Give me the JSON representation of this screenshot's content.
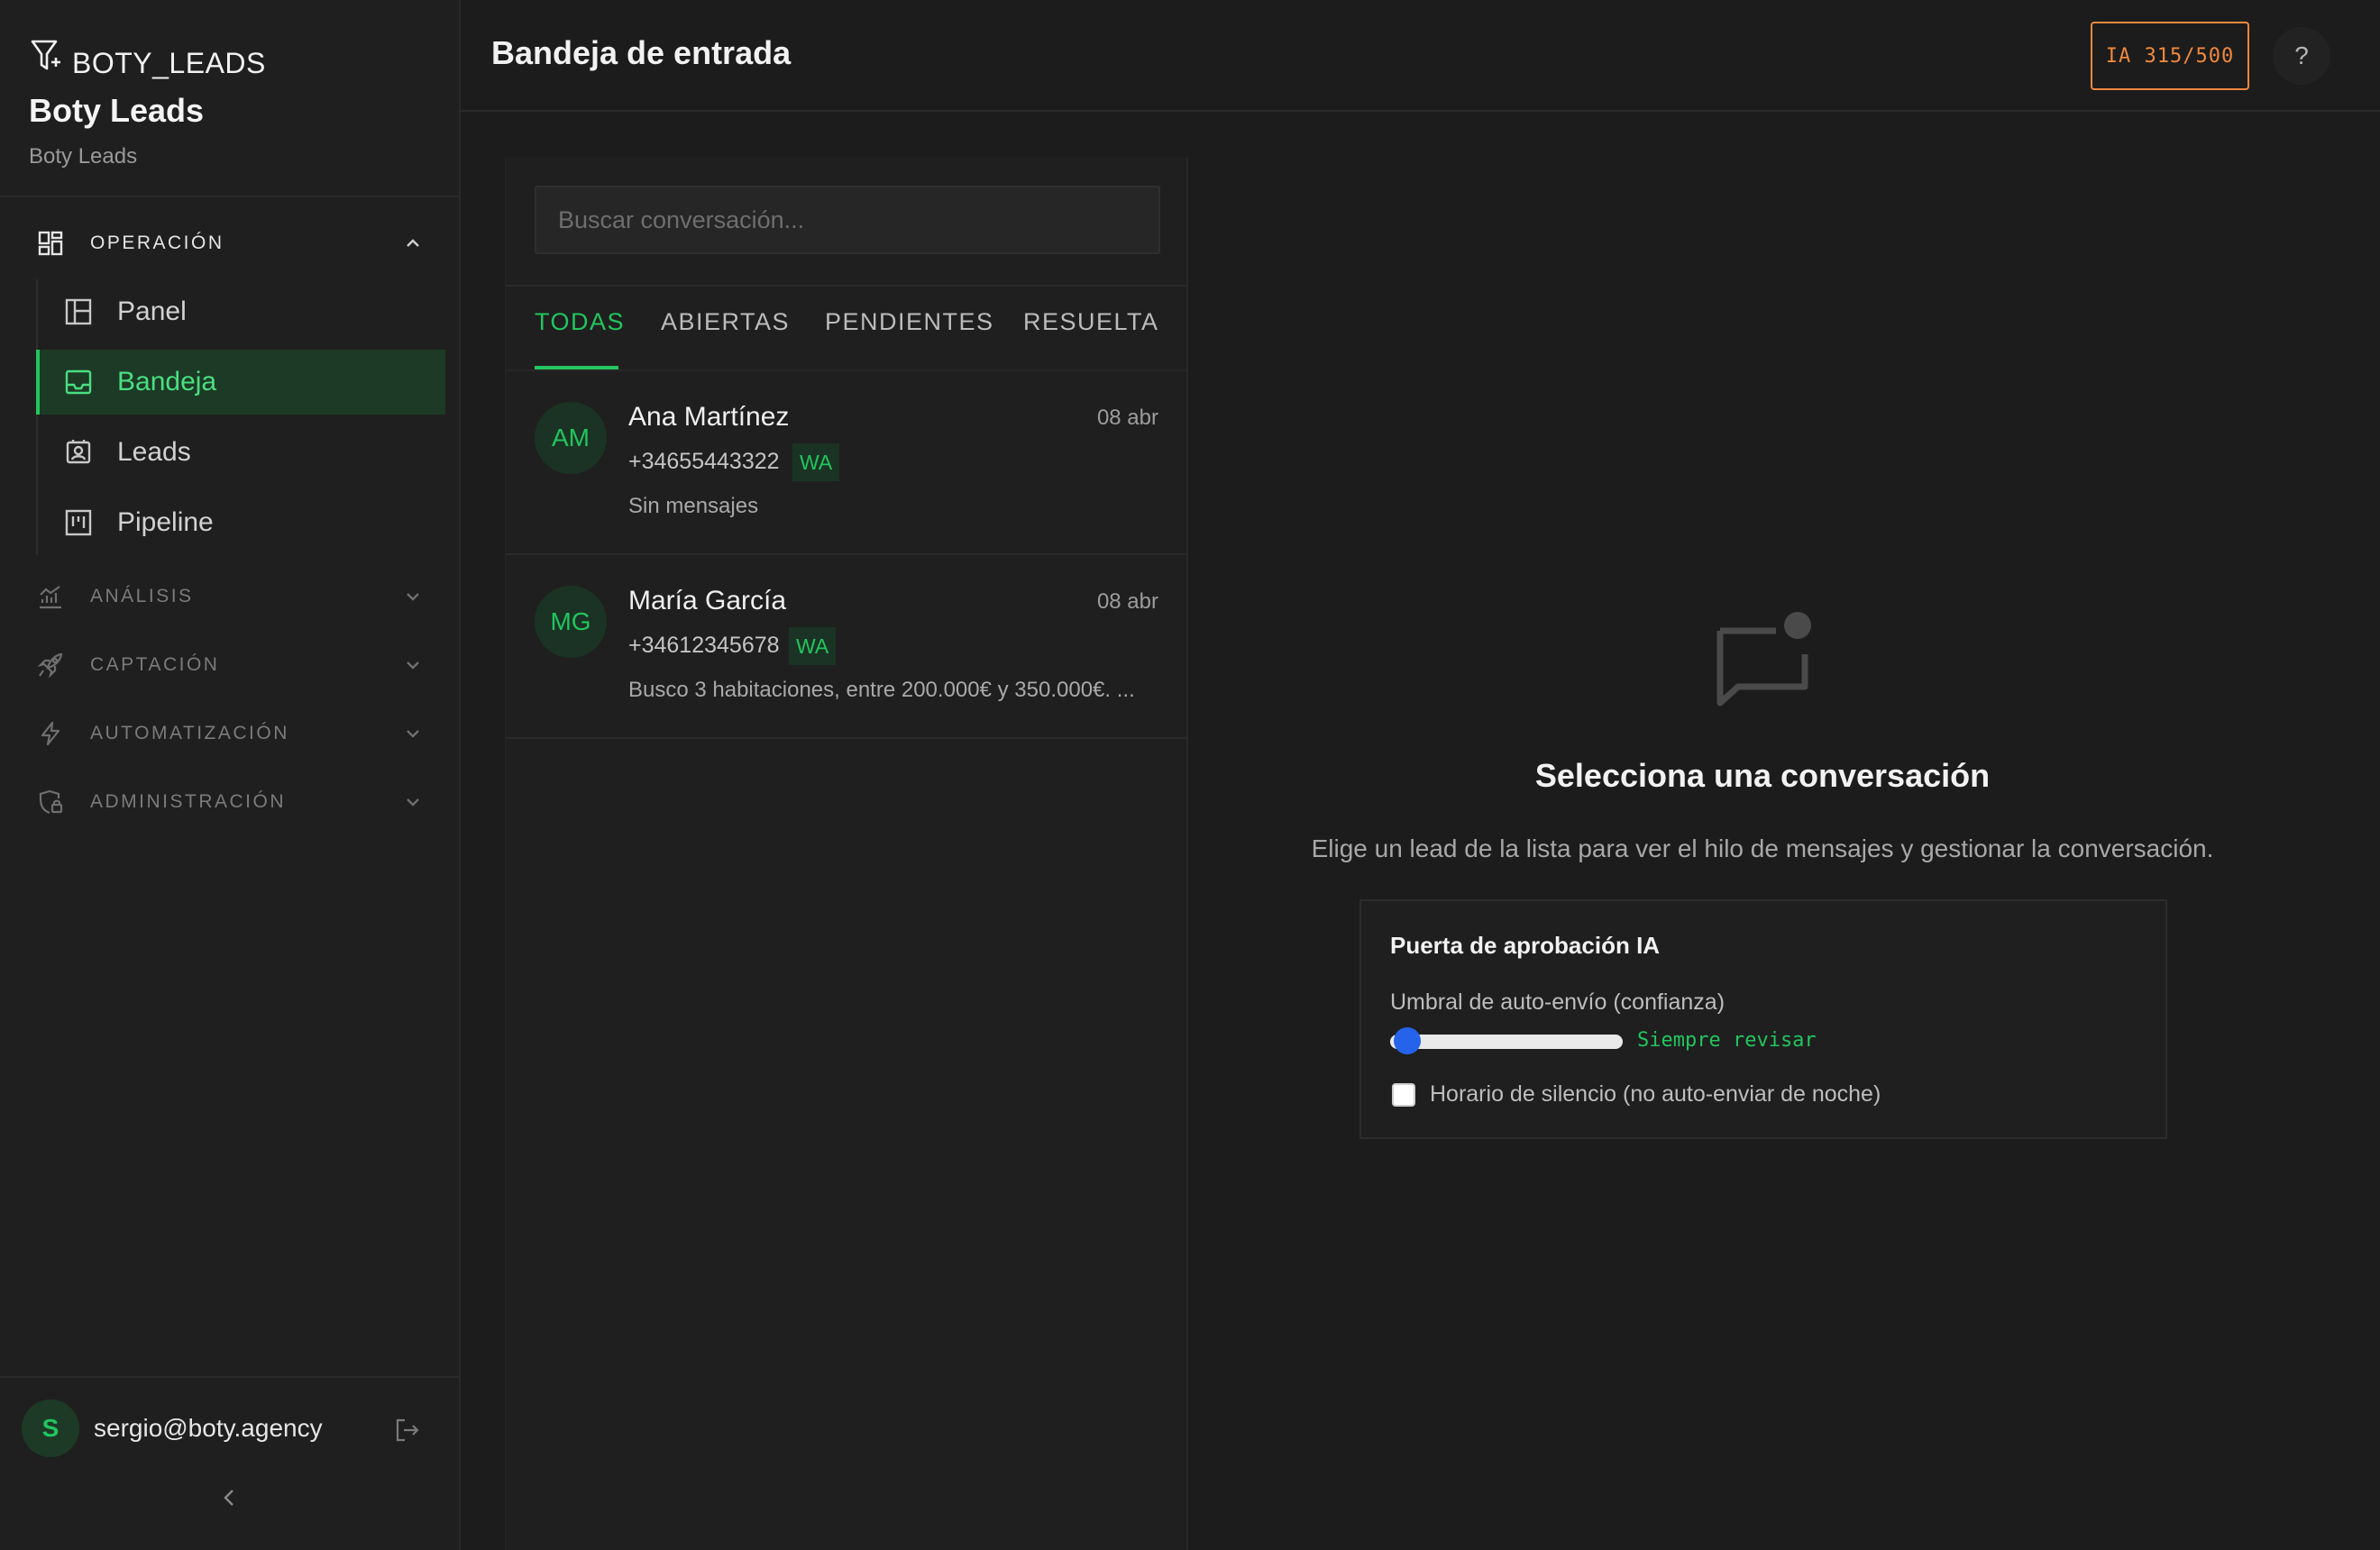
{
  "brand": {
    "logo_text": "BOTY_LEADS",
    "name": "Boty Leads",
    "subtitle": "Boty Leads"
  },
  "sidebar": {
    "sections": [
      {
        "label": "OPERACIÓN",
        "expanded": true
      },
      {
        "label": "ANÁLISIS",
        "expanded": false
      },
      {
        "label": "CAPTACIÓN",
        "expanded": false
      },
      {
        "label": "AUTOMATIZACIÓN",
        "expanded": false
      },
      {
        "label": "ADMINISTRACIÓN",
        "expanded": false
      }
    ],
    "items": [
      {
        "label": "Panel",
        "icon": "layout-icon",
        "active": false
      },
      {
        "label": "Bandeja",
        "icon": "inbox-icon",
        "active": true
      },
      {
        "label": "Leads",
        "icon": "contact-icon",
        "active": false
      },
      {
        "label": "Pipeline",
        "icon": "kanban-icon",
        "active": false
      }
    ],
    "user": {
      "initial": "S",
      "email": "sergio@boty.agency"
    }
  },
  "header": {
    "title": "Bandeja de entrada",
    "ia_quota": "IA 315/500",
    "help_label": "?"
  },
  "inbox": {
    "search_placeholder": "Buscar conversación...",
    "tabs": [
      "TODAS",
      "ABIERTAS",
      "PENDIENTES",
      "RESUELTAS"
    ],
    "active_tab": "TODAS",
    "conversations": [
      {
        "initials": "AM",
        "name": "Ana Martínez",
        "date": "08 abr",
        "phone": "+34655443322",
        "channel": "WA",
        "preview": "Sin mensajes"
      },
      {
        "initials": "MG",
        "name": "María García",
        "date": "08 abr",
        "phone": "+34612345678",
        "channel": "WA",
        "preview": "Busco 3 habitaciones, entre 200.000€ y 350.000€. ..."
      }
    ]
  },
  "empty_state": {
    "title": "Selecciona una conversación",
    "description": "Elige un lead de la lista para ver el hilo de mensajes y gestionar la conversación."
  },
  "approval_gate": {
    "title": "Puerta de aprobación IA",
    "threshold_label": "Umbral de auto-envío (confianza)",
    "threshold_value": 0,
    "threshold_text": "Siempre revisar",
    "quiet_hours_label": "Horario de silencio (no auto-enviar de noche)",
    "quiet_hours_checked": false
  },
  "colors": {
    "accent": "#22c55e",
    "quota": "#f0883e",
    "slider_thumb": "#2563eb",
    "background": "#1c1c1c"
  }
}
